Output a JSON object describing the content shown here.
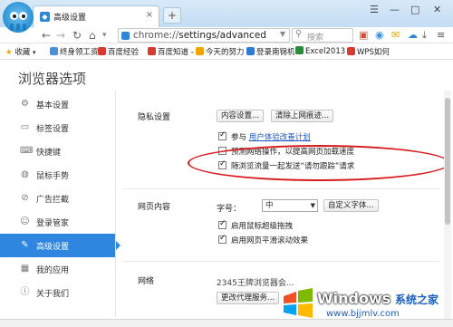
{
  "browser": {
    "tab_title": "高级设置",
    "tab_close": "×",
    "new_tab": "+",
    "window_buttons": [
      "☰",
      "—",
      "□",
      "✕"
    ],
    "address_prefix": "chrome://",
    "address_rest": "settings/advanced",
    "search_placeholder": "搜索",
    "back_icon": "back-arrow-icon",
    "forward_icon": "forward-arrow-icon",
    "reload_icon": "reload-icon",
    "home_icon": "home-icon"
  },
  "bookmarks": {
    "favorites_label": "收藏",
    "items": [
      {
        "label": "终身领工资",
        "color": "#4a8fd8"
      },
      {
        "label": "百度经验",
        "color": "#d63a2f"
      },
      {
        "label": "百度知道 -",
        "color": "#d63a2f"
      },
      {
        "label": "今天的努力",
        "color": "#f0a500"
      },
      {
        "label": "登录南锦机",
        "color": "#2d7bd1"
      },
      {
        "label": "Excel2013",
        "color": "#2d8a3a"
      },
      {
        "label": "WPS如何",
        "color": "#d63a2f"
      }
    ]
  },
  "page": {
    "title": "浏览器选项"
  },
  "sidebar": {
    "items": [
      {
        "label": "基本设置",
        "icon": "gear-icon",
        "glyph": "⚙",
        "active": false
      },
      {
        "label": "标签设置",
        "icon": "tab-icon",
        "glyph": "▭",
        "active": false
      },
      {
        "label": "快捷键",
        "icon": "keyboard-icon",
        "glyph": "⌨",
        "active": false
      },
      {
        "label": "鼠标手势",
        "icon": "mouse-icon",
        "glyph": "◍",
        "active": false
      },
      {
        "label": "广告拦截",
        "icon": "block-icon",
        "glyph": "⊘",
        "active": false
      },
      {
        "label": "登录管家",
        "icon": "user-icon",
        "glyph": "☺",
        "active": false
      },
      {
        "label": "高级设置",
        "icon": "wrench-icon",
        "glyph": "✎",
        "active": true
      },
      {
        "label": "我的应用",
        "icon": "apps-icon",
        "glyph": "▦",
        "active": false
      },
      {
        "label": "关于我们",
        "icon": "info-icon",
        "glyph": "ⓘ",
        "active": false
      }
    ]
  },
  "privacy": {
    "label": "隐私设置",
    "content_settings_button": "内容设置...",
    "clear_history_button": "清除上网痕迹...",
    "improvement_prefix": "参与",
    "improvement_link": "用户体验改善计划",
    "predict_network": "预测网络操作，以提高网页加载速度",
    "do_not_track": "随浏览流量一起发送“请勿跟踪”请求"
  },
  "web_content": {
    "label": "网页内容",
    "font_size_label": "字号：",
    "font_size_value": "中",
    "custom_fonts_button": "自定义字体...",
    "super_drag": "启用鼠标超级拖拽",
    "smooth_scroll": "启用网页平滑滚动效果"
  },
  "network": {
    "label": "网络",
    "description": "2345王牌浏览器会...",
    "proxy_button": "更改代理服务..."
  },
  "watermark": {
    "title": "Windows",
    "subtitle": "系统之家",
    "url": "www.bjjmlv.com"
  }
}
